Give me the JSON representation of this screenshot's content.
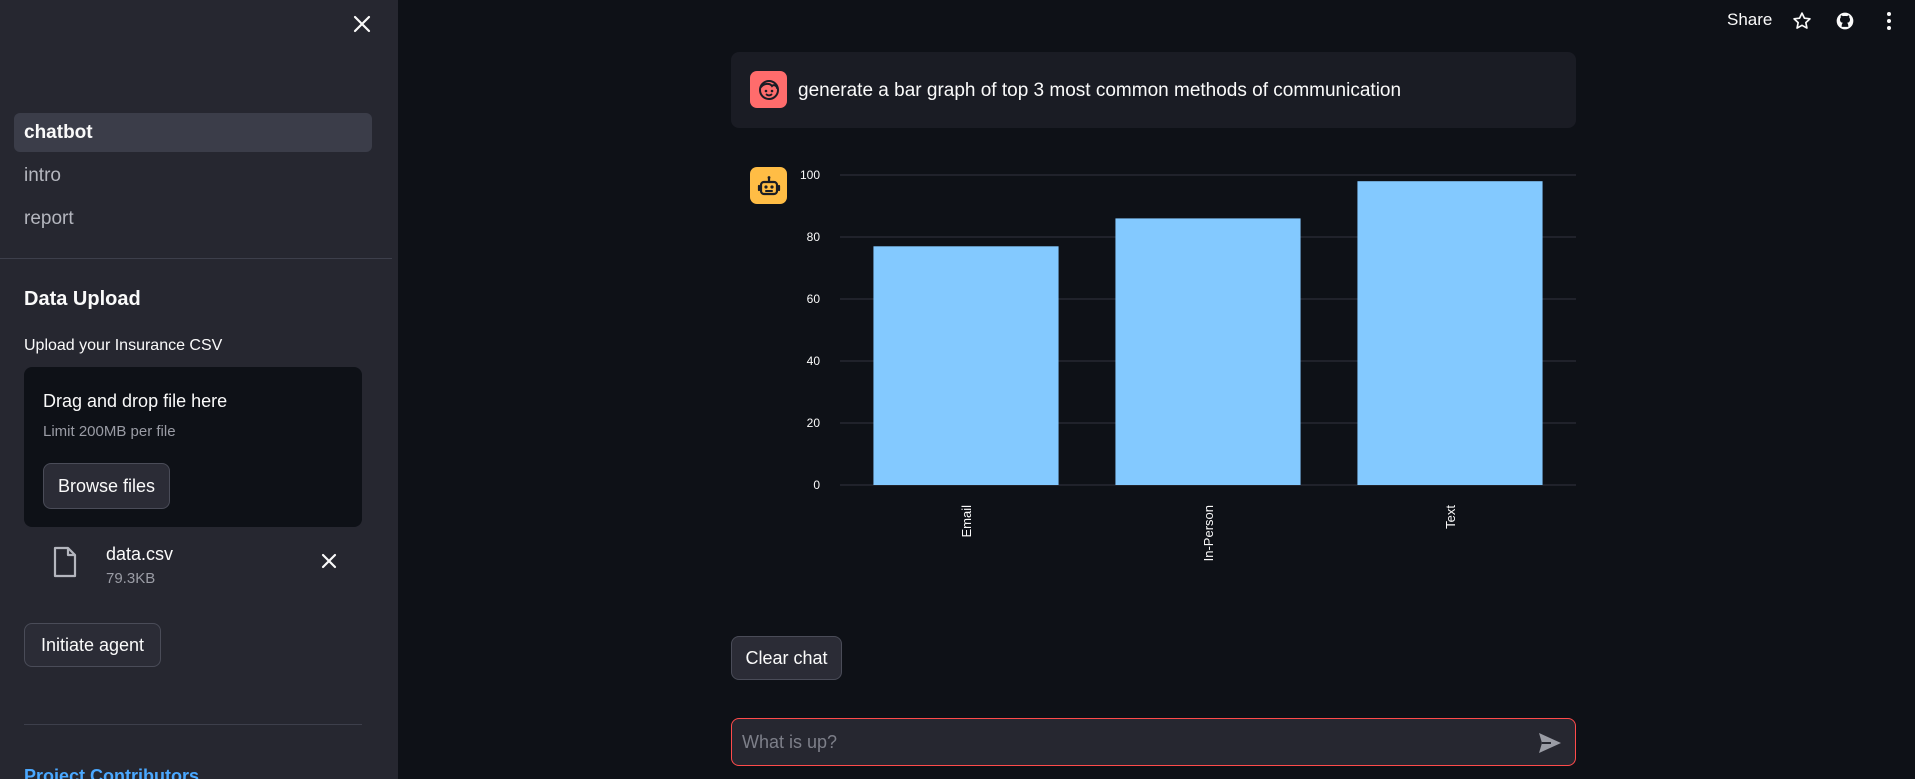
{
  "sidebar": {
    "nav": [
      {
        "label": "chatbot"
      },
      {
        "label": "intro"
      },
      {
        "label": "report"
      }
    ],
    "section_title": "Data Upload",
    "upload_label": "Upload your Insurance CSV",
    "dropzone": {
      "title": "Drag and drop file here",
      "limit": "Limit 200MB per file",
      "browse_label": "Browse files"
    },
    "file": {
      "name": "data.csv",
      "size": "79.3KB"
    },
    "initiate_label": "Initiate agent",
    "contributors_link": "Project Contributors"
  },
  "header": {
    "share_label": "Share"
  },
  "chat": {
    "user_message": "generate a bar graph of top 3 most common methods of communication",
    "clear_label": "Clear chat",
    "input_placeholder": "What is up?"
  },
  "colors": {
    "bar": "#83c9ff",
    "user_avatar": "#ff6c6c",
    "bot_avatar": "#ffbd45",
    "input_border": "#ff4b4b"
  },
  "chart_data": {
    "type": "bar",
    "categories": [
      "Email",
      "In-Person",
      "Text"
    ],
    "values": [
      77,
      86,
      98
    ],
    "title": "",
    "xlabel": "",
    "ylabel": "",
    "ylim": [
      0,
      100
    ],
    "yticks": [
      0,
      20,
      40,
      60,
      80,
      100
    ],
    "grid": true
  }
}
